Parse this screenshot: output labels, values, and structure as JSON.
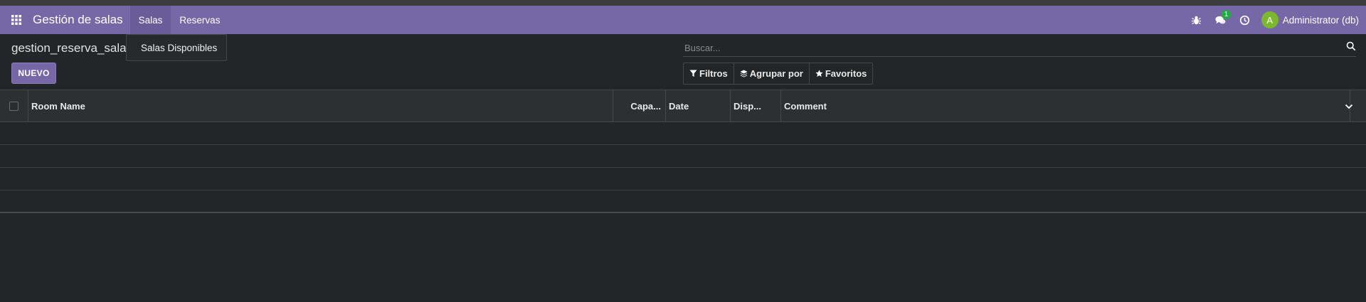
{
  "navbar": {
    "app_title": "Gestión de salas",
    "menu": [
      {
        "label": "Salas",
        "active": true
      },
      {
        "label": "Reservas",
        "active": false
      }
    ],
    "messages_badge": "1",
    "user_initial": "A",
    "user_name": "Administrator (db)",
    "colors": {
      "navbar": "#7667a6",
      "avatar": "#7cb82f",
      "badge": "#28a745"
    }
  },
  "dropdown": {
    "items": [
      "Salas Disponibles"
    ]
  },
  "control_panel": {
    "breadcrumb": "gestion_reserva_sala",
    "new_button": "NUEVO",
    "search_placeholder": "Buscar...",
    "filters_label": "Filtros",
    "group_by_label": "Agrupar por",
    "favorites_label": "Favoritos"
  },
  "table": {
    "columns": [
      "Room Name",
      "Capa...",
      "Date",
      "Disp...",
      "Comment"
    ],
    "rows": []
  },
  "icons": [
    "apps-grid-icon",
    "bug-icon",
    "chat-icon",
    "clock-icon",
    "search-icon",
    "filter-icon",
    "layers-icon",
    "star-icon",
    "chevron-down-icon"
  ]
}
